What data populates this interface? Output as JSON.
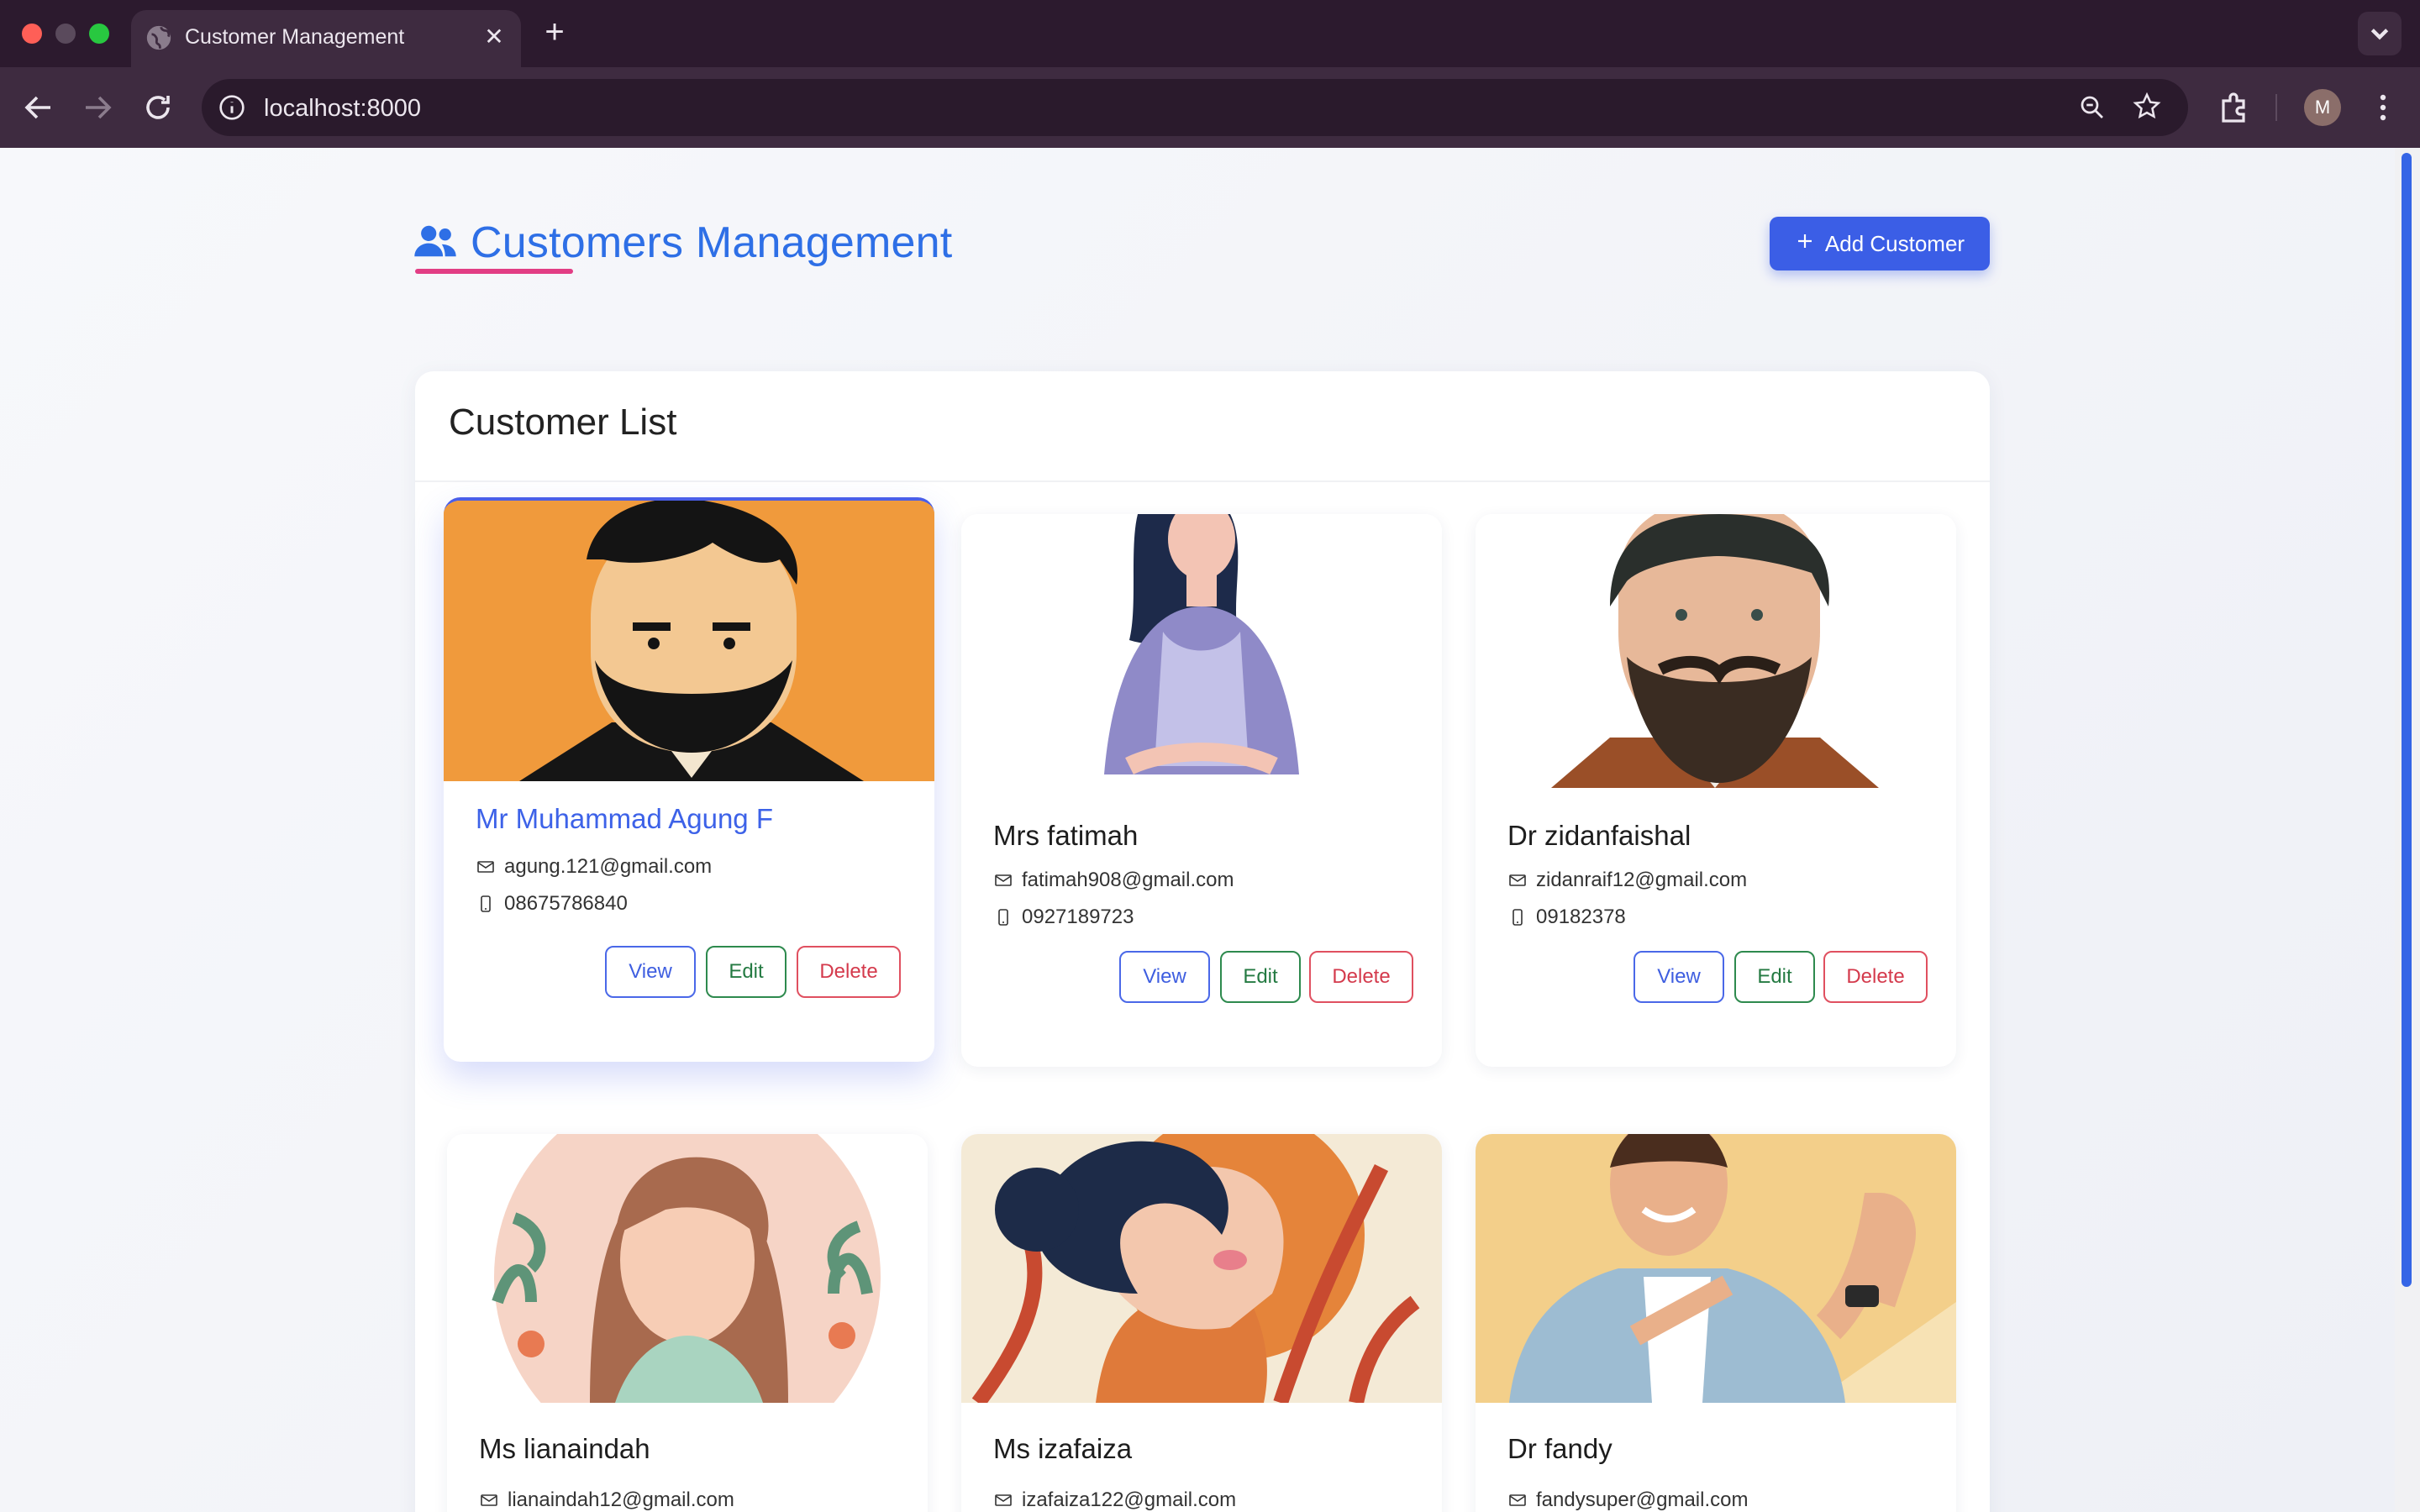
{
  "browser": {
    "tab_title": "Customer Management",
    "url": "localhost:8000",
    "profile_initial": "M",
    "icons": [
      "globe-icon",
      "close-icon",
      "plus-icon",
      "chevron-down-icon",
      "back-icon",
      "forward-icon",
      "reload-icon",
      "info-icon",
      "zoom-icon",
      "star-icon",
      "extensions-icon",
      "menu-icon"
    ]
  },
  "header": {
    "title": "Customers Management",
    "add_button": "Add Customer",
    "accent": "#2e6fe6",
    "underline_color": "#e23d84"
  },
  "list": {
    "title": "Customer List",
    "buttons": {
      "view": "View",
      "edit": "Edit",
      "delete": "Delete"
    },
    "customers": [
      {
        "name": "Mr Muhammad Agung F",
        "email": "agung.121@gmail.com",
        "phone": "08675786840",
        "portrait": "bearded-man-orange-bg"
      },
      {
        "name": "Mrs fatimah",
        "email": "fatimah908@gmail.com",
        "phone": "0927189723",
        "portrait": "woman-purple-cardigan"
      },
      {
        "name": "Dr zidanfaishal",
        "email": "zidanraif12@gmail.com",
        "phone": "09182378",
        "portrait": "bearded-man-mustache"
      },
      {
        "name": "Ms lianaindah",
        "email": "lianaindah12@gmail.com",
        "phone": "",
        "portrait": "woman-long-hair-floral"
      },
      {
        "name": "Ms izafaiza",
        "email": "izafaiza122@gmail.com",
        "phone": "",
        "portrait": "woman-profile-bun"
      },
      {
        "name": "Dr fandy",
        "email": "fandysuper@gmail.com",
        "phone": "",
        "portrait": "man-thumbs-up"
      }
    ]
  }
}
